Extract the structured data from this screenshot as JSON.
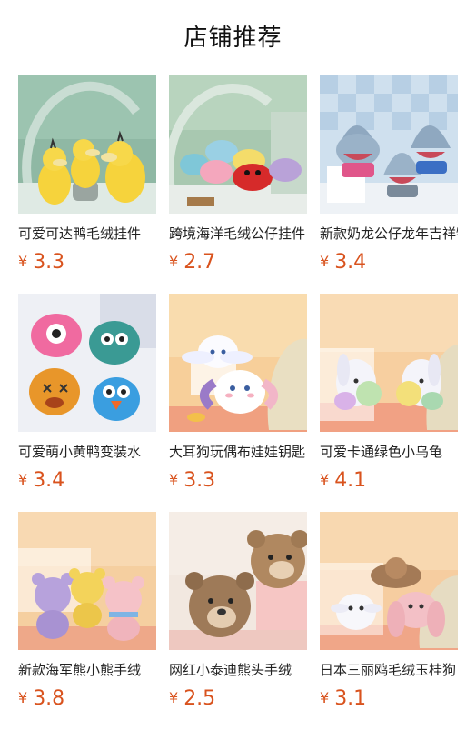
{
  "header": {
    "title": "店铺推荐"
  },
  "colors": {
    "price": "#d9531e",
    "title": "#111111"
  },
  "products": [
    {
      "name": "可爱可达鸭毛绒挂件",
      "currency": "¥",
      "price": "3.3",
      "image_icon": "yellow-duck-plush-image"
    },
    {
      "name": "跨境海洋毛绒公仔挂件",
      "currency": "¥",
      "price": "2.7",
      "image_icon": "crab-plush-image"
    },
    {
      "name": "新款奶龙公仔龙年吉祥物",
      "currency": "¥",
      "price": "3.4",
      "image_icon": "shark-plush-image"
    },
    {
      "name": "可爱萌小黄鸭变装水",
      "currency": "¥",
      "price": "3.4",
      "image_icon": "monster-plush-image"
    },
    {
      "name": "大耳狗玩偶布娃娃钥匙",
      "currency": "¥",
      "price": "3.3",
      "image_icon": "cinnamoroll-plush-image"
    },
    {
      "name": "可爱卡通绿色小乌龟",
      "currency": "¥",
      "price": "4.1",
      "image_icon": "bunny-plush-image"
    },
    {
      "name": "新款海军熊小熊手绒",
      "currency": "¥",
      "price": "3.8",
      "image_icon": "bear-plush-image"
    },
    {
      "name": "网红小泰迪熊头手绒",
      "currency": "¥",
      "price": "2.5",
      "image_icon": "teddy-head-plush-image"
    },
    {
      "name": "日本三丽鸥毛绒玉桂狗",
      "currency": "¥",
      "price": "3.1",
      "image_icon": "sanrio-plush-image"
    }
  ]
}
